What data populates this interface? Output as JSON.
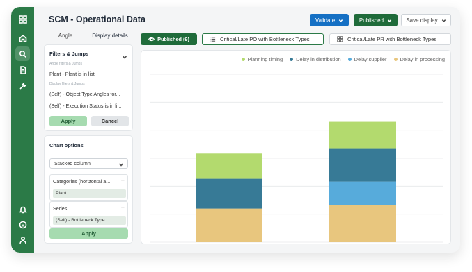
{
  "header": {
    "title": "SCM - Operational Data",
    "validate_label": "Validate",
    "published_label": "Published",
    "save_display_label": "Save display"
  },
  "sidebar_icons": [
    "grid-icon",
    "home-icon",
    "search-icon",
    "document-icon",
    "wrench-icon",
    "bell-icon",
    "info-icon",
    "user-icon"
  ],
  "tabs": {
    "angle": "Angle",
    "display_details": "Display details"
  },
  "filters": {
    "title": "Filters & Jumps",
    "angle_filters_caption": "Angle filters & Jumps",
    "angle_filter_1": "Plant - Plant is in list",
    "display_filters_caption": "Display filters & Jumps",
    "display_filter_1": "(Self) - Object Type Angles for...",
    "display_filter_2": "(Self) - Execution Status is in li...",
    "apply_label": "Apply",
    "cancel_label": "Cancel"
  },
  "chart_options": {
    "title": "Chart options",
    "chart_type": "Stacked column",
    "categories_label": "Categories (horizontal a...",
    "categories_value": "Plant",
    "series_label": "Series",
    "series_value": "(Self) - Bottleneck Type",
    "apply_label": "Apply"
  },
  "toolbar": {
    "published_count_label": "Published (9)",
    "display_1": "Critical/Late PO with Bottleneck Types",
    "display_2": "Critical/Late PR with Bottleneck Types"
  },
  "colors": {
    "green": "#b3da6e",
    "teal": "#377a96",
    "lightblue": "#57abdb",
    "tan": "#e8c67e"
  },
  "chart_data": {
    "type": "bar",
    "stacked": true,
    "categories": [
      "",
      ""
    ],
    "ylim": [
      0,
      9
    ],
    "grid": true,
    "legend": "top-right",
    "series": [
      {
        "name": "Delay in processing",
        "color": "#e8c67e",
        "values": [
          1.8,
          2.0
        ]
      },
      {
        "name": "Delay supplier",
        "color": "#57abdb",
        "values": [
          0,
          1.25
        ]
      },
      {
        "name": "Delay in distribution",
        "color": "#377a96",
        "values": [
          1.6,
          1.75
        ]
      },
      {
        "name": "Planning timing",
        "color": "#b3da6e",
        "values": [
          1.35,
          1.45
        ]
      }
    ],
    "legend_order": [
      "Planning timing",
      "Delay in distribution",
      "Delay supplier",
      "Delay in processing"
    ]
  }
}
